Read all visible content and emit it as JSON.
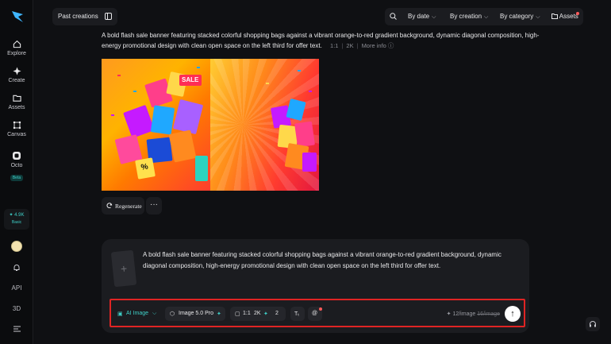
{
  "sidebar": {
    "items": [
      {
        "label": "Explore",
        "icon": "home-icon"
      },
      {
        "label": "Create",
        "icon": "sparkle-icon"
      },
      {
        "label": "Assets",
        "icon": "folder-icon"
      },
      {
        "label": "Canvas",
        "icon": "canvas-icon"
      },
      {
        "label": "Octo",
        "icon": "octo-icon",
        "badge": "Beta"
      }
    ],
    "credits": {
      "value": "4.9K",
      "tier": "Basic"
    },
    "api_label": "API",
    "threed_label": "3D"
  },
  "topbar": {
    "past_creations": "Past creations",
    "filters": [
      "By date",
      "By creation",
      "By category"
    ],
    "assets": "Assets"
  },
  "generation": {
    "prompt": "A bold flash sale banner featuring stacked colorful shopping bags against a vibrant orange-to-red gradient background, dynamic diagonal composition, high-energy promotional design with clean open space on the left third for offer text.",
    "ratio": "1:1",
    "resolution": "2K",
    "more_info": "More info",
    "sale_tag": "SALE",
    "percent_tag": "%",
    "regenerate": "Regenerate"
  },
  "composer": {
    "text": "A bold flash sale banner featuring stacked colorful shopping bags against a vibrant orange-to-red gradient background, dynamic diagonal composition, high-energy promotional design with clean open space on the left third for offer text.",
    "mode": "AI Image",
    "model": "Image 5.0 Pro",
    "ratio": "1:1",
    "resolution": "2K",
    "count": "2",
    "cost_now": "12/image",
    "cost_old": "16/image"
  },
  "colors": {
    "accent": "#3fd0c8",
    "highlight_border": "#e02424"
  }
}
